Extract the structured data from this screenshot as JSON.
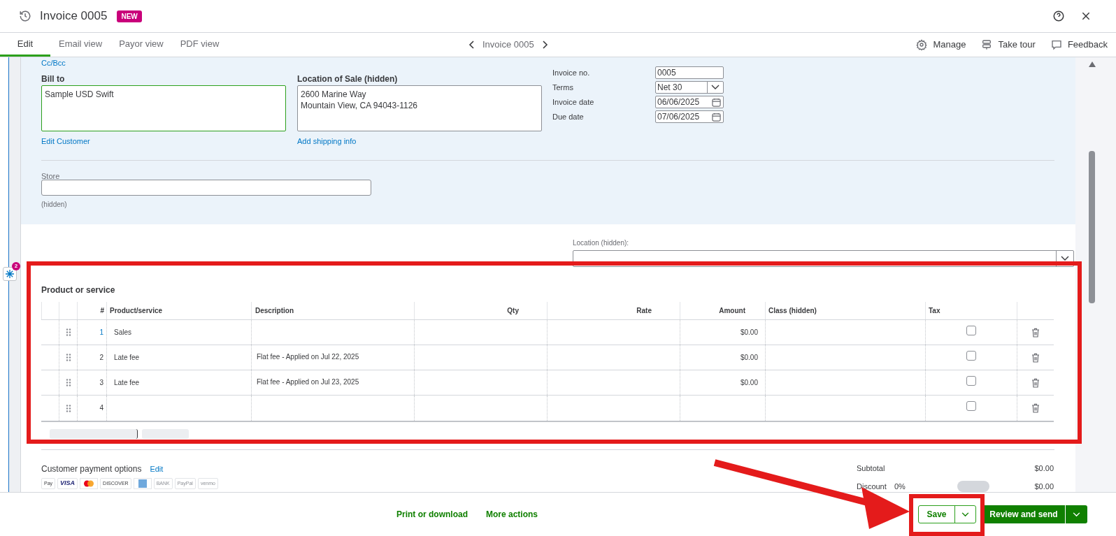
{
  "header": {
    "title": "Invoice 0005",
    "badge": "NEW"
  },
  "tabs": [
    {
      "label": "Edit",
      "selected": true
    },
    {
      "label": "Email view",
      "selected": false
    },
    {
      "label": "Payor view",
      "selected": false
    },
    {
      "label": "PDF view",
      "selected": false
    }
  ],
  "navigator": {
    "label": "Invoice 0005"
  },
  "toolbar": [
    {
      "kind": "gear",
      "label": "Manage"
    },
    {
      "kind": "signpost",
      "label": "Take tour"
    },
    {
      "kind": "chat",
      "label": "Feedback"
    }
  ],
  "form": {
    "cc_link": "Cc/Bcc",
    "bill_to": {
      "label": "Bill to",
      "value": "Sample USD Swift",
      "link": "Edit Customer"
    },
    "location_of_sale": {
      "label": "Location of Sale (hidden)",
      "lines": [
        "2600 Marine Way",
        "Mountain View, CA 94043-1126"
      ],
      "link": "Add shipping info"
    },
    "fields": [
      {
        "kind": "text",
        "label": "Invoice no.",
        "value": "0005"
      },
      {
        "kind": "select",
        "label": "Terms",
        "value": "Net 30"
      },
      {
        "kind": "date",
        "label": "Invoice date",
        "value": "06/06/2025"
      },
      {
        "kind": "date",
        "label": "Due date",
        "value": "07/06/2025"
      }
    ],
    "store": {
      "label": "Store",
      "note": "(hidden)"
    },
    "location": {
      "label": "Location (hidden):"
    }
  },
  "helper": {
    "badge": "2"
  },
  "products": {
    "title": "Product or service",
    "columns": [
      "#",
      "Product/service",
      "Description",
      "Qty",
      "Rate",
      "Amount",
      "Class (hidden)",
      "Tax"
    ],
    "rows": [
      {
        "number": "1",
        "product": "Sales",
        "description": "",
        "amount": "$0.00",
        "tax": false
      },
      {
        "number": "2",
        "product": "Late fee",
        "description": "Flat fee - Applied on Jul 22, 2025",
        "amount": "$0.00",
        "tax": false
      },
      {
        "number": "3",
        "product": "Late fee",
        "description": "Flat fee - Applied on Jul 23, 2025",
        "amount": "$0.00",
        "tax": false
      },
      {
        "number": "4",
        "product": "",
        "description": "",
        "amount": "",
        "tax": false
      }
    ]
  },
  "payment": {
    "title": "Customer payment options",
    "link": "Edit",
    "methods": [
      {
        "kind": "text",
        "label": "Pay"
      },
      {
        "kind": "text",
        "label": "VISA"
      },
      {
        "kind": "mastercard"
      },
      {
        "kind": "text",
        "label": "DISCOVER"
      },
      {
        "kind": "amex"
      },
      {
        "kind": "text",
        "label": "BANK"
      },
      {
        "kind": "text",
        "label": "PayPal"
      },
      {
        "kind": "text",
        "label": "venmo"
      }
    ]
  },
  "totals": {
    "subtotal_label": "Subtotal",
    "subtotal": "$0.00",
    "discount_label": "Discount",
    "discount_percent": "0%",
    "discount": "$0.00",
    "discount_on": false
  },
  "footer": {
    "links": [
      "Print or download",
      "More actions"
    ],
    "save": "Save",
    "primary": "Review and send"
  }
}
